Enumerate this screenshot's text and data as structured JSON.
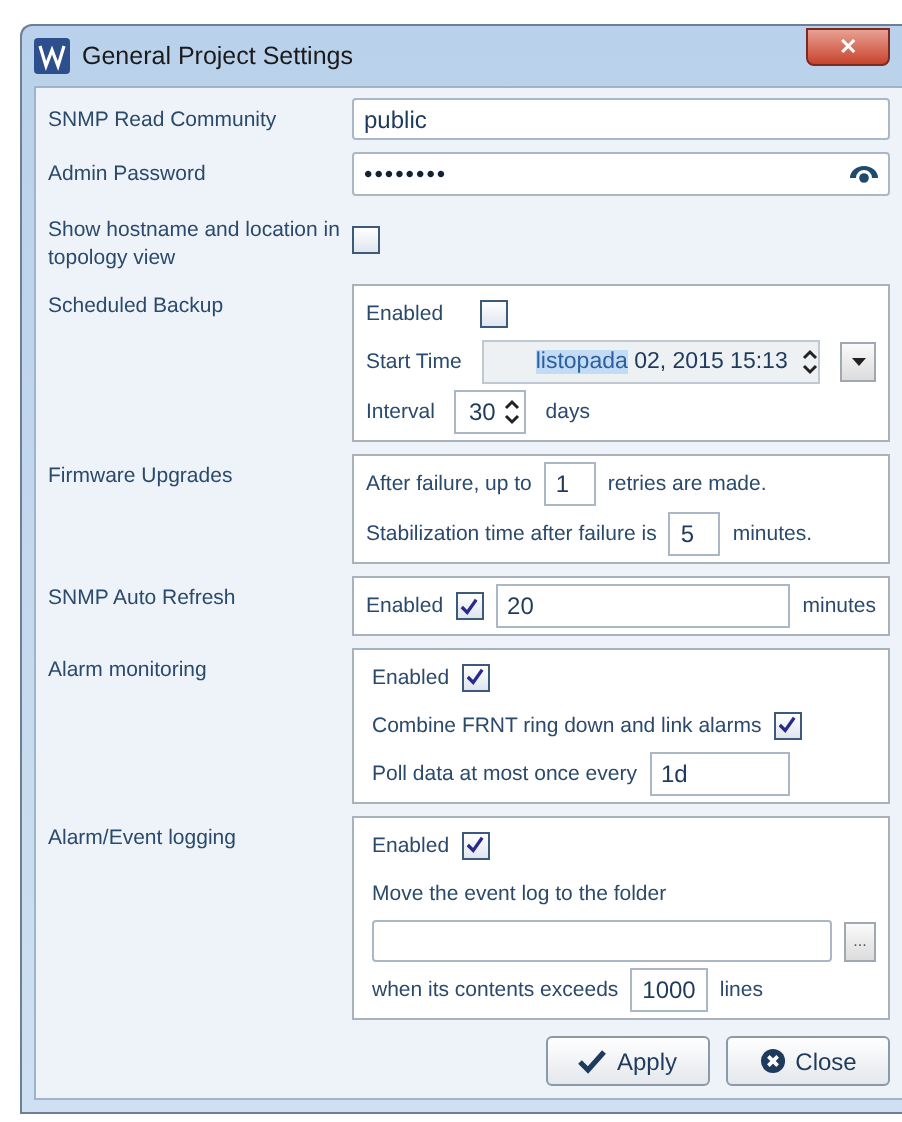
{
  "window": {
    "title": "General Project Settings",
    "close": "✕"
  },
  "snmp_read_community": {
    "label": "SNMP Read Community",
    "value": "public"
  },
  "admin_password": {
    "label": "Admin Password",
    "value": "••••••••"
  },
  "show_hostname": {
    "label": "Show hostname and location in topology view",
    "checked": false
  },
  "scheduled_backup": {
    "label": "Scheduled Backup",
    "enabled_label": "Enabled",
    "enabled": false,
    "start_time_label": "Start Time",
    "start_time_selected": "listopada",
    "start_time_rest": " 02, 2015 15:13",
    "interval_label": "Interval",
    "interval": "30",
    "interval_unit": "days"
  },
  "firmware_upgrades": {
    "label": "Firmware Upgrades",
    "retries_before": "After failure, up to",
    "retries": "1",
    "retries_after": "retries are made.",
    "stabilization_before": "Stabilization time after failure is",
    "stabilization": "5",
    "stabilization_after": "minutes."
  },
  "snmp_auto_refresh": {
    "label": "SNMP Auto Refresh",
    "enabled_label": "Enabled",
    "enabled": true,
    "value": "20",
    "unit": "minutes"
  },
  "alarm_monitoring": {
    "label": "Alarm monitoring",
    "enabled_label": "Enabled",
    "enabled": true,
    "combine_label": "Combine FRNT ring down and link alarms",
    "combine": true,
    "poll_label": "Poll data at most once every",
    "poll": "1d"
  },
  "alarm_event_logging": {
    "label": "Alarm/Event logging",
    "enabled_label": "Enabled",
    "enabled": true,
    "folder_label": "Move the event log to the folder",
    "browse": "...",
    "exceeds_before": "when its contents exceeds",
    "exceeds": "1000",
    "exceeds_after": "lines"
  },
  "buttons": [
    {
      "kind": "apply",
      "label": "Apply"
    },
    {
      "kind": "close",
      "label": "Close"
    }
  ]
}
